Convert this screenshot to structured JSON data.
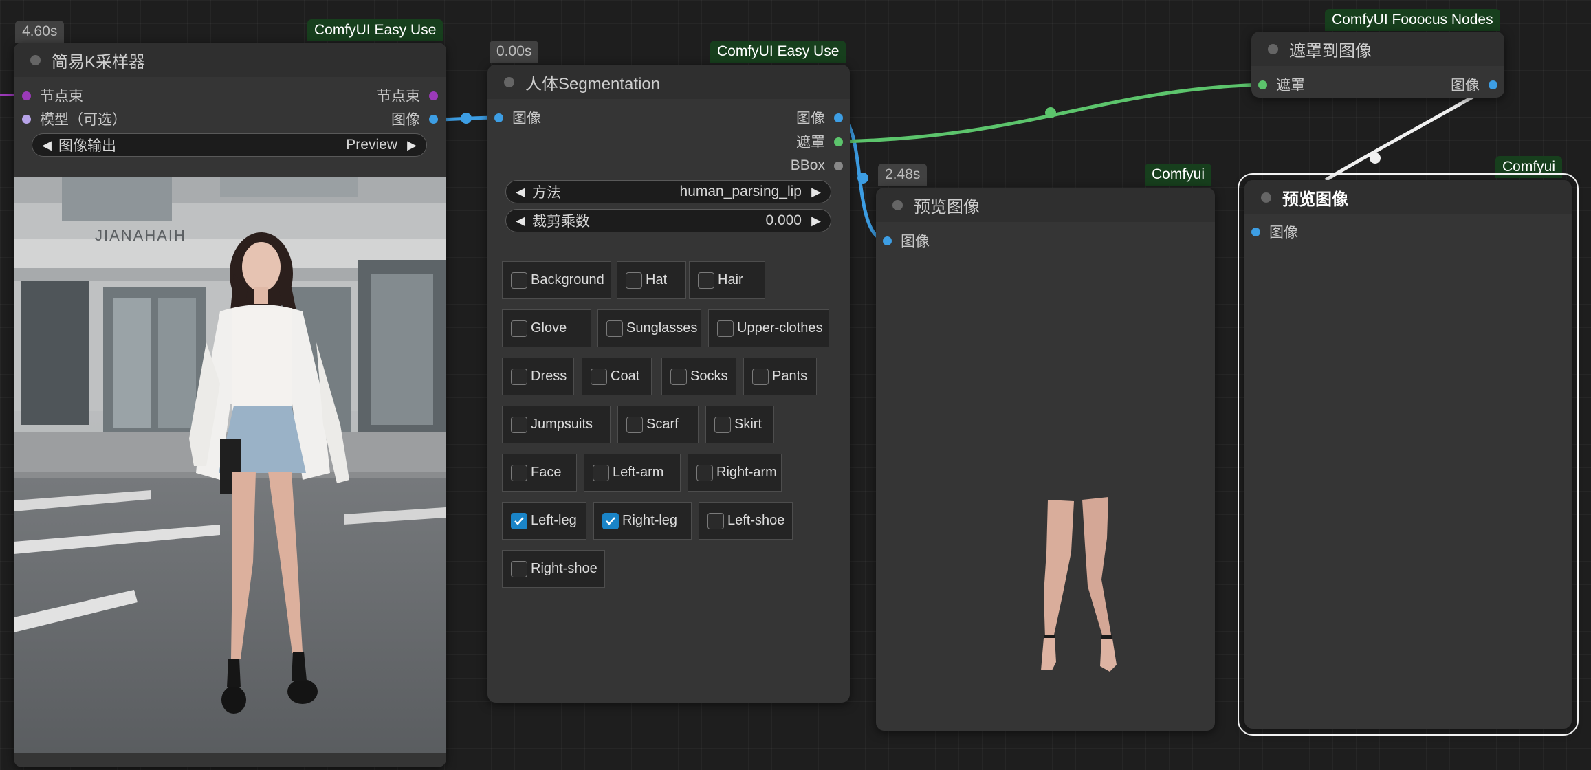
{
  "colors": {
    "canvas_bg": "#1e1e1e",
    "node_body": "#353535",
    "node_title": "#2f2f2f",
    "source_badge_bg": "#173f1d",
    "slot_image": "#3d9ee4",
    "slot_mask": "#5cc46c",
    "slot_bbox": "#888888",
    "slot_pipe": "#9b3ab9",
    "slot_model": "#b7a3e8",
    "wire_image": "#3d9ee4",
    "wire_mask": "#5cc46c",
    "wire_white": "#f0f0f0",
    "checkbox_checked": "#1a84c7"
  },
  "ksampler": {
    "time": "4.60s",
    "source": "ComfyUI Easy Use",
    "title": "简易K采样器",
    "inputs": [
      "节点束",
      "模型（可选）"
    ],
    "outputs": [
      "节点束",
      "图像"
    ],
    "widget": {
      "label": "图像输出",
      "value": "Preview"
    },
    "preview_image": "photo of a young woman in a white blazer and denim skirt standing on a street"
  },
  "segmentation": {
    "time": "0.00s",
    "source": "ComfyUI Easy Use",
    "title": "人体Segmentation",
    "inputs": [
      "图像"
    ],
    "outputs": [
      "图像",
      "遮罩",
      "BBox"
    ],
    "method": {
      "label": "方法",
      "value": "human_parsing_lip"
    },
    "crop": {
      "label": "裁剪乘数",
      "value": "0.000"
    },
    "parts": [
      {
        "label": "Background",
        "checked": false
      },
      {
        "label": "Hat",
        "checked": false
      },
      {
        "label": "Hair",
        "checked": false
      },
      {
        "label": "Glove",
        "checked": false
      },
      {
        "label": "Sunglasses",
        "checked": false
      },
      {
        "label": "Upper-clothes",
        "checked": false
      },
      {
        "label": "Dress",
        "checked": false
      },
      {
        "label": "Coat",
        "checked": false
      },
      {
        "label": "Socks",
        "checked": false
      },
      {
        "label": "Pants",
        "checked": false
      },
      {
        "label": "Jumpsuits",
        "checked": false
      },
      {
        "label": "Scarf",
        "checked": false
      },
      {
        "label": "Skirt",
        "checked": false
      },
      {
        "label": "Face",
        "checked": false
      },
      {
        "label": "Left-arm",
        "checked": false
      },
      {
        "label": "Right-arm",
        "checked": false
      },
      {
        "label": "Left-leg",
        "checked": true
      },
      {
        "label": "Right-leg",
        "checked": true
      },
      {
        "label": "Left-shoe",
        "checked": false
      },
      {
        "label": "Right-shoe",
        "checked": false
      }
    ]
  },
  "preview1": {
    "time": "2.48s",
    "source": "Comfyui",
    "title": "预览图像",
    "inputs": [
      "图像"
    ],
    "preview_image": "segmented legs with black ankle straps on transparent background"
  },
  "mask_to_image": {
    "source": "ComfyUI Fooocus Nodes",
    "title": "遮罩到图像",
    "inputs": [
      "遮罩"
    ],
    "outputs": [
      "图像"
    ]
  },
  "preview2": {
    "source": "Comfyui",
    "title": "预览图像",
    "inputs": [
      "图像"
    ]
  }
}
